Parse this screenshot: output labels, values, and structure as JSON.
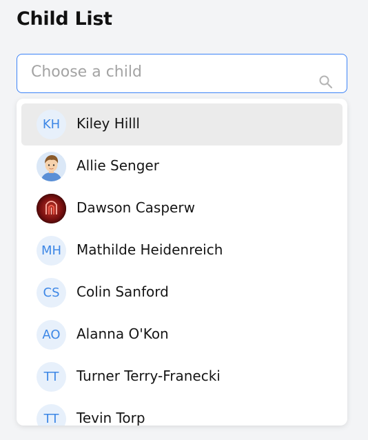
{
  "page": {
    "title": "Child List"
  },
  "search": {
    "placeholder": "Choose a child",
    "value": ""
  },
  "options": [
    {
      "initials": "KH",
      "name": "Kiley Hilll",
      "avatar": "initials",
      "highlighted": true
    },
    {
      "initials": "",
      "name": "Allie Senger",
      "avatar": "boy-cartoon-photo",
      "highlighted": false
    },
    {
      "initials": "",
      "name": "Dawson Casperw",
      "avatar": "red-neon-photo",
      "highlighted": false
    },
    {
      "initials": "MH",
      "name": "Mathilde Heidenreich",
      "avatar": "initials",
      "highlighted": false
    },
    {
      "initials": "CS",
      "name": "Colin Sanford",
      "avatar": "initials",
      "highlighted": false
    },
    {
      "initials": "AO",
      "name": "Alanna O'Kon",
      "avatar": "initials",
      "highlighted": false
    },
    {
      "initials": "TT",
      "name": "Turner Terry-Franecki",
      "avatar": "initials",
      "highlighted": false
    },
    {
      "initials": "TT",
      "name": "Tevin Torp",
      "avatar": "initials",
      "highlighted": false
    }
  ],
  "colors": {
    "accent": "#3b82f6",
    "avatar_bg": "#e7f0fb",
    "avatar_text": "#3d87e6",
    "highlight_bg": "#ebebeb"
  }
}
